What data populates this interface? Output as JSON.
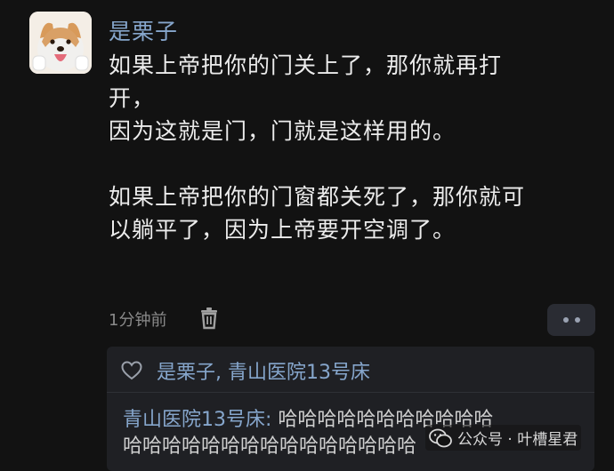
{
  "comment": {
    "username": "是栗子",
    "text": "如果上帝把你的门关上了，那你就再打\n开，\n因为这就是门，门就是这样用的。\n\n如果上帝把你的门窗都关死了，那你就可\n以躺平了，因为上帝要开空调了。",
    "time": "1分钟前"
  },
  "reply": {
    "likers": "是栗子, 青山医院13号床",
    "author": "青山医院13号床:",
    "text_line1": "哈哈哈哈哈哈哈哈哈哈哈",
    "text_line2": "哈哈哈哈哈哈哈哈哈哈哈哈哈哈哈"
  },
  "watermark": {
    "text": "公众号 · 叶槽星君"
  },
  "icons": {
    "trash": "trash-icon",
    "more": "more-dots-icon",
    "heart": "heart-outline-icon",
    "wechat": "wechat-icon"
  },
  "colors": {
    "background": "#121212",
    "username": "#86a6cc",
    "text": "#ececec",
    "muted": "#8a8a8a",
    "panel": "#1f2024"
  }
}
